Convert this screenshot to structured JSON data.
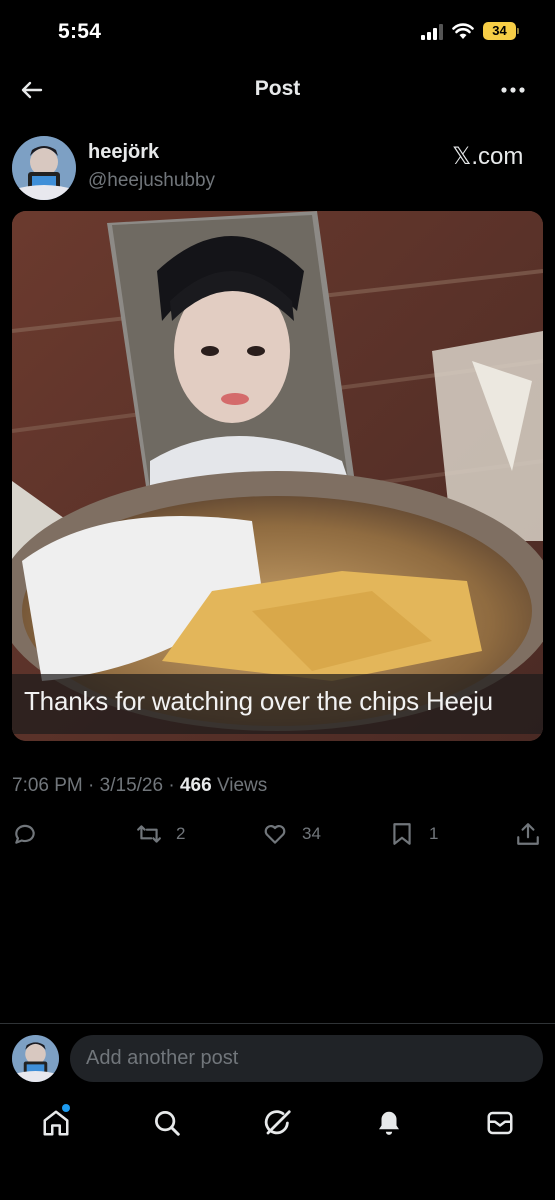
{
  "status_bar": {
    "time": "5:54",
    "battery": "34"
  },
  "header": {
    "title": "Post"
  },
  "post": {
    "author_name": "heejörk",
    "author_handle": "@heejushubby",
    "source": "𝕏.com",
    "caption": "Thanks for watching over the chips Heeju",
    "time": "7:06 PM",
    "date": "3/15/26",
    "views": "466",
    "views_label": "Views",
    "stats": {
      "replies": "",
      "reposts": "2",
      "likes": "34",
      "bookmarks": "1"
    }
  },
  "reply": {
    "placeholder": "Add another post"
  },
  "icons": {
    "back": "arrow-left-icon",
    "more": "more-horizontal-icon",
    "reply": "speech-bubble-icon",
    "repost": "repost-arrows-icon",
    "like": "heart-icon",
    "bookmark": "bookmark-icon",
    "share": "upload-icon",
    "tab_home": "home-icon",
    "tab_search": "search-icon",
    "tab_grok": "grok-icon",
    "tab_notifications": "bell-icon",
    "tab_messages": "mail-icon"
  },
  "colors": {
    "background": "#000000",
    "text": "#e7e9ea",
    "secondary": "#71767b",
    "accent": "#1d9bf0",
    "battery": "#f7ce46"
  }
}
